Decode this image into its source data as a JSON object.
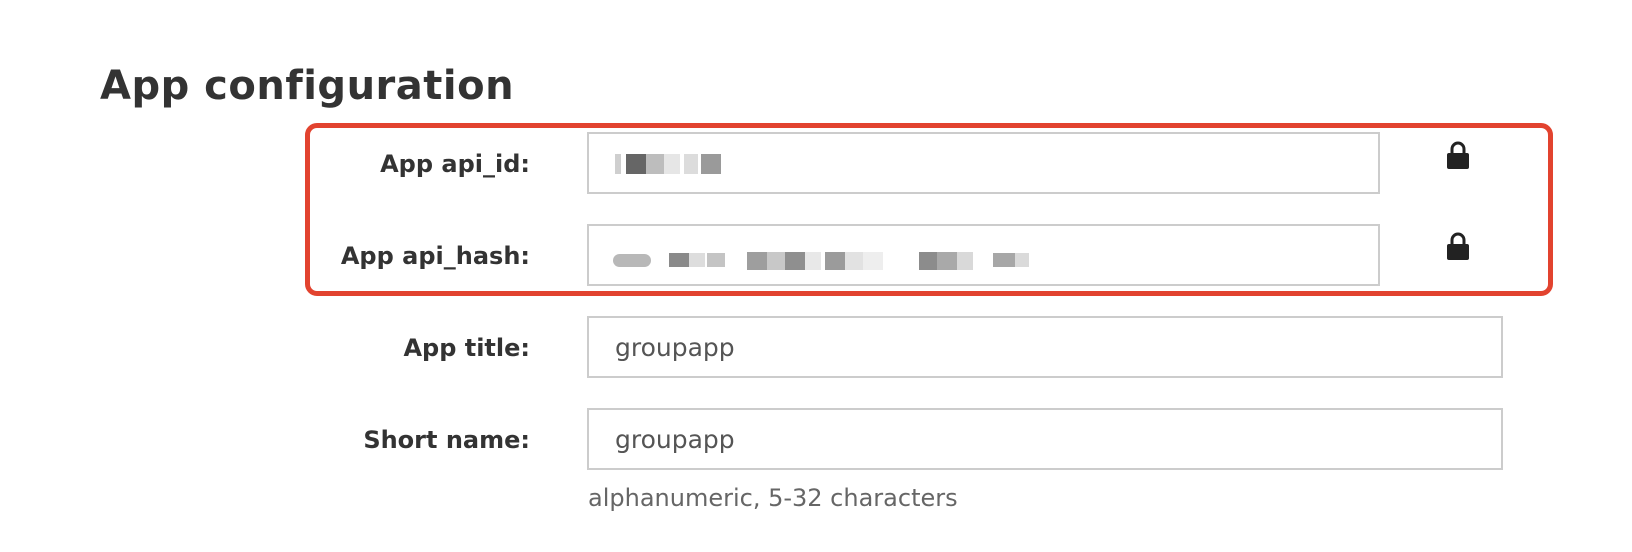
{
  "page": {
    "title": "App configuration"
  },
  "fields": {
    "api_id": {
      "label": "App api_id:",
      "value_state": "redacted",
      "lock_icon": "lock-icon"
    },
    "api_hash": {
      "label": "App api_hash:",
      "value_state": "redacted",
      "lock_icon": "lock-icon"
    },
    "app_title": {
      "label": "App title:",
      "value": "groupapp"
    },
    "short_name": {
      "label": "Short name:",
      "value": "groupapp",
      "hint": "alphanumeric, 5-32 characters"
    }
  },
  "colors": {
    "highlight_border": "#e2432f",
    "text": "#333333",
    "input_border": "#cccccc",
    "hint_text": "#666666"
  }
}
